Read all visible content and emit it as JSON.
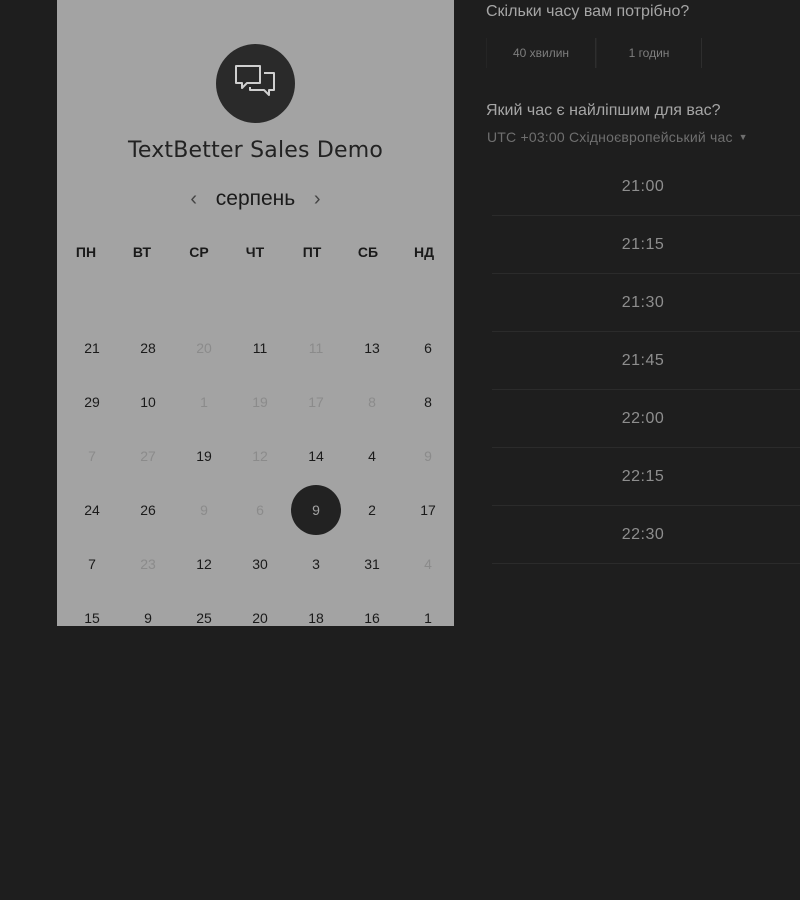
{
  "title": "TextBetter Sales Demo",
  "month": "серпень",
  "weekdays": [
    "ПН",
    "ВТ",
    "СР",
    "ЧТ",
    "ПТ",
    "СБ",
    "НД"
  ],
  "weeks": [
    [
      {
        "d": "21",
        "m": false
      },
      {
        "d": "28",
        "m": false
      },
      {
        "d": "20",
        "m": true
      },
      {
        "d": "11",
        "m": false
      },
      {
        "d": "11",
        "m": true
      },
      {
        "d": "13",
        "m": false
      },
      {
        "d": "6",
        "m": false
      }
    ],
    [
      {
        "d": "29",
        "m": false
      },
      {
        "d": "10",
        "m": false
      },
      {
        "d": "1",
        "m": true
      },
      {
        "d": "19",
        "m": true
      },
      {
        "d": "17",
        "m": true
      },
      {
        "d": "8",
        "m": true
      },
      {
        "d": "8",
        "m": false
      }
    ],
    [
      {
        "d": "7",
        "m": true
      },
      {
        "d": "27",
        "m": true
      },
      {
        "d": "19",
        "m": false
      },
      {
        "d": "12",
        "m": true
      },
      {
        "d": "14",
        "m": false
      },
      {
        "d": "4",
        "m": false
      },
      {
        "d": "9",
        "m": true
      }
    ],
    [
      {
        "d": "24",
        "m": false
      },
      {
        "d": "26",
        "m": false
      },
      {
        "d": "9",
        "m": true
      },
      {
        "d": "6",
        "m": true
      },
      {
        "d": "9",
        "m": false,
        "selected": true
      },
      {
        "d": "2",
        "m": false
      },
      {
        "d": "17",
        "m": false
      }
    ],
    [
      {
        "d": "7",
        "m": false
      },
      {
        "d": "23",
        "m": true
      },
      {
        "d": "12",
        "m": false
      },
      {
        "d": "30",
        "m": false
      },
      {
        "d": "3",
        "m": false
      },
      {
        "d": "31",
        "m": false
      },
      {
        "d": "4",
        "m": true
      }
    ],
    [
      {
        "d": "15",
        "m": false
      },
      {
        "d": "9",
        "m": false
      },
      {
        "d": "25",
        "m": false
      },
      {
        "d": "20",
        "m": false
      },
      {
        "d": "18",
        "m": false
      },
      {
        "d": "16",
        "m": false
      },
      {
        "d": "1",
        "m": false
      }
    ]
  ],
  "duration_question": "Скільки часу вам потрібно?",
  "durations": [
    "40 хвилин",
    "1 годин"
  ],
  "time_question": "Який час є найліпшим для вас?",
  "timezone": "UTC +03:00 Східноєвропейський час",
  "slots": [
    "21:00",
    "21:15",
    "21:30",
    "21:45",
    "22:00",
    "22:15",
    "22:30"
  ]
}
